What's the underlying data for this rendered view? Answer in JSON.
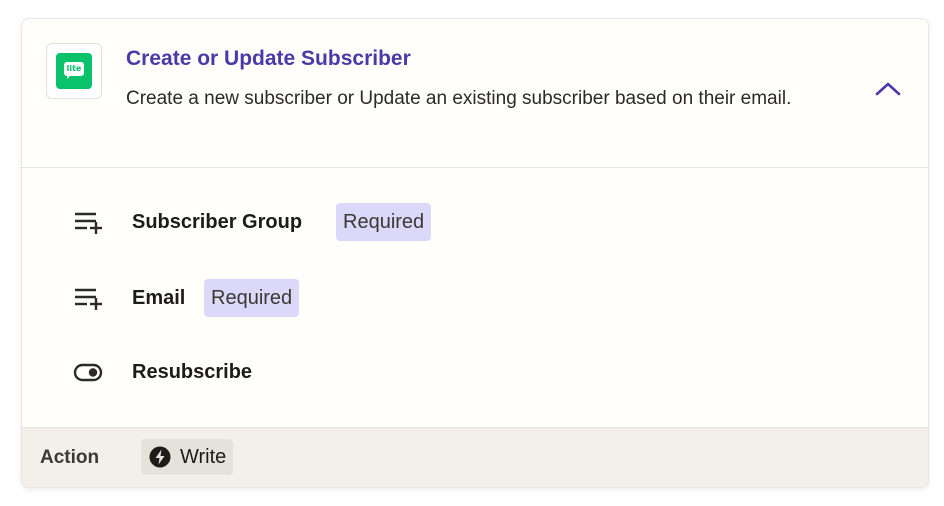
{
  "step": {
    "app_logo_text": "lite",
    "title": "Create or Update Subscriber",
    "description": "Create a new subscriber or Update an existing subscriber based on their email.",
    "collapse_icon": "chevron-up-icon"
  },
  "fields": [
    {
      "label": "Subscriber Group",
      "badge": "Required",
      "icon": "playlist-add-icon"
    },
    {
      "label": "Email",
      "badge": "Required",
      "icon": "playlist-add-icon"
    },
    {
      "label": "Resubscribe",
      "badge": "",
      "icon": "toggle-icon"
    }
  ],
  "footer": {
    "label": "Action",
    "type_label": "Write",
    "type_icon": "bolt-icon"
  },
  "colors": {
    "accent": "#4a3aa8",
    "badge_bg": "#dcd8fa",
    "logo_green": "#09c269",
    "footer_bg": "#f2f0e9"
  }
}
